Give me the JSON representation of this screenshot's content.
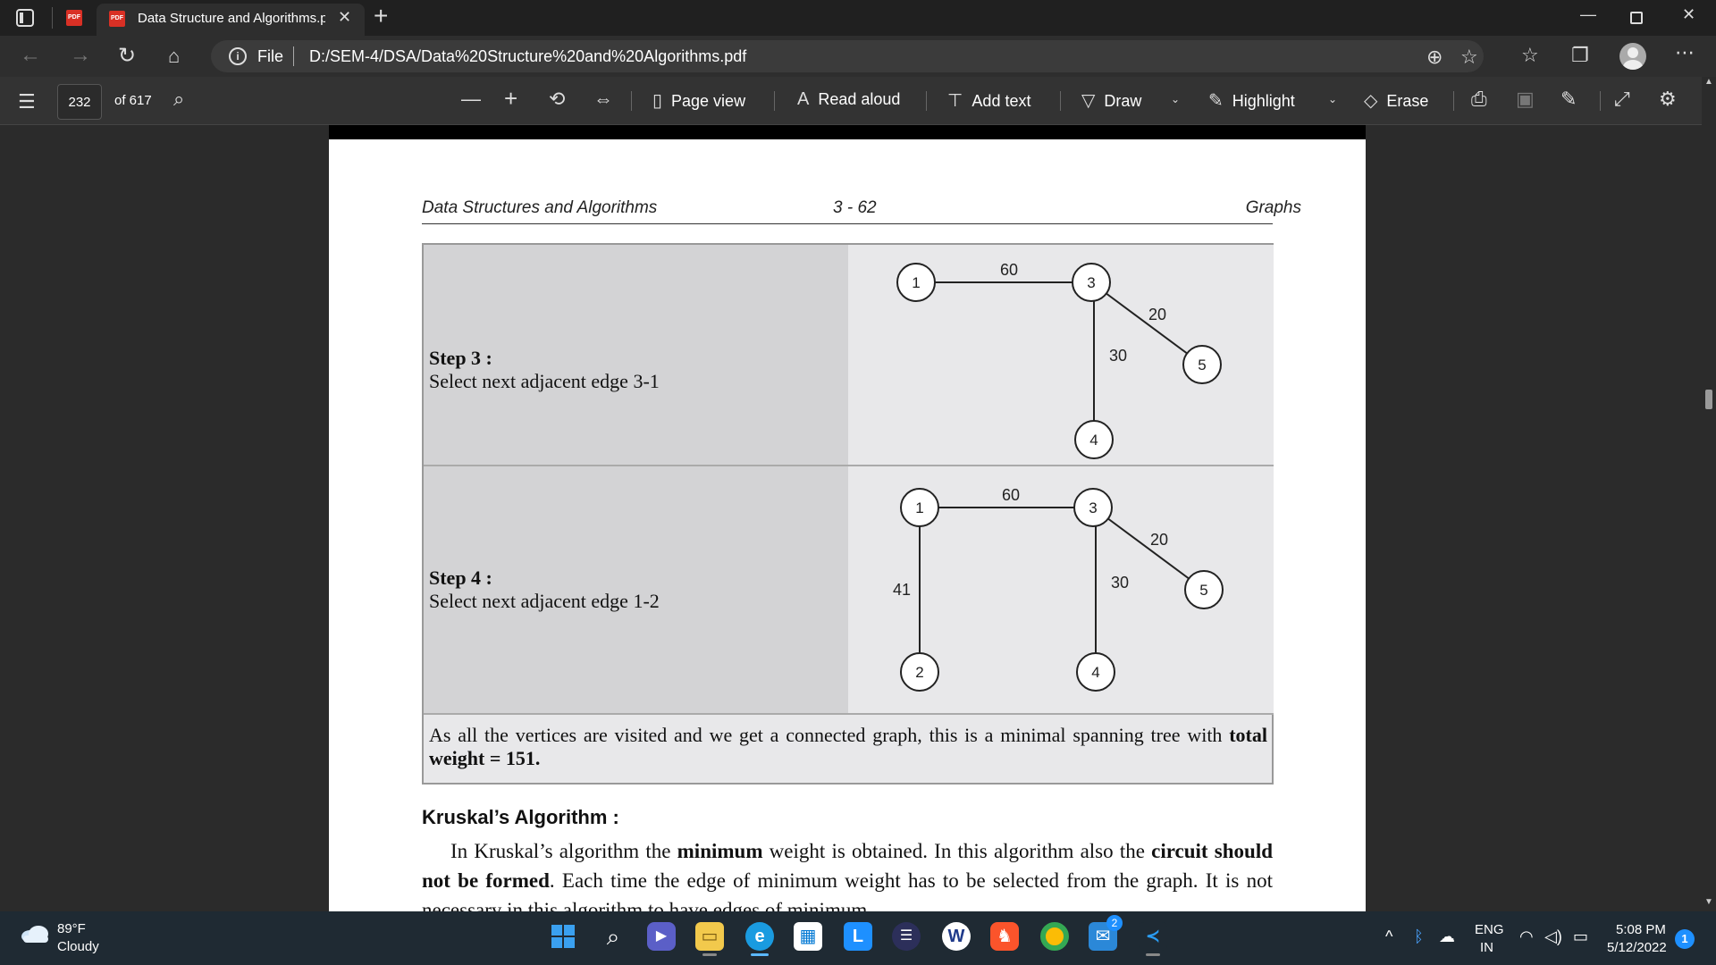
{
  "browser": {
    "tab": {
      "title": "Data Structure and Algorithms.pdf"
    },
    "address": {
      "file_label": "File",
      "url": "D:/SEM-4/DSA/Data%20Structure%20and%20Algorithms.pdf"
    }
  },
  "pdf_toolbar": {
    "page_current": "232",
    "page_total": "of 617",
    "page_view": "Page view",
    "read_aloud": "Read aloud",
    "add_text": "Add text",
    "draw": "Draw",
    "highlight": "Highlight",
    "erase": "Erase"
  },
  "document": {
    "running_header": {
      "left": "Data Structures and Algorithms",
      "center": "3 - 62",
      "right": "Graphs"
    },
    "steps": [
      {
        "title": "Step 3 :",
        "description": "Select next adjacent edge 3-1",
        "graph": {
          "nodes": [
            "1",
            "3",
            "5",
            "4"
          ],
          "edges": [
            {
              "from": "1",
              "to": "3",
              "weight": "60"
            },
            {
              "from": "3",
              "to": "5",
              "weight": "20"
            },
            {
              "from": "3",
              "to": "4",
              "weight": "30"
            }
          ]
        }
      },
      {
        "title": "Step 4 :",
        "description": "Select next adjacent edge 1-2",
        "graph": {
          "nodes": [
            "1",
            "3",
            "5",
            "2",
            "4"
          ],
          "edges": [
            {
              "from": "1",
              "to": "3",
              "weight": "60"
            },
            {
              "from": "3",
              "to": "5",
              "weight": "20"
            },
            {
              "from": "1",
              "to": "2",
              "weight": "41"
            },
            {
              "from": "3",
              "to": "4",
              "weight": "30"
            }
          ]
        }
      }
    ],
    "conclusion": {
      "text_before": "As all the vertices are visited and we get a connected graph, this is a minimal spanning tree with ",
      "bold": "total weight = 151."
    },
    "kruskal": {
      "heading": "Kruskal’s Algorithm :",
      "p1": "In Kruskal’s algorithm the ",
      "b1": "minimum",
      "p2": " weight is obtained. In this algorithm also the ",
      "b2": "circuit should not be formed",
      "p3": ". Each time the edge of minimum weight has to be selected from the graph. It is not necessary in this algorithm to have edges of minimum"
    }
  },
  "taskbar": {
    "weather": {
      "temp": "89°F",
      "desc": "Cloudy"
    },
    "mail_badge": "2",
    "language": {
      "line1": "ENG",
      "line2": "IN"
    },
    "clock": {
      "time": "5:08 PM",
      "date": "5/12/2022"
    },
    "notifications": "1"
  }
}
